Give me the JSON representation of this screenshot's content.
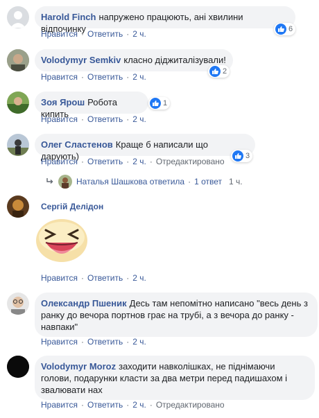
{
  "colors": {
    "link_blue": "#385898",
    "bubble_bg": "#f2f3f5",
    "meta_gray": "#606770",
    "like_blue": "#2078f4"
  },
  "labels": {
    "like": "Нравится",
    "reply": "Ответить",
    "edited": "Отредактировано",
    "separator": "·"
  },
  "comments": [
    {
      "author": "Harold Finch",
      "text": "напружено працюють, ані хвилини відпочинку",
      "time": "2 ч.",
      "likes": "6",
      "avatar": "default-avatar"
    },
    {
      "author": "Volodymyr Semkiv",
      "text": "класно діджиталізували!",
      "time": "2 ч.",
      "likes": "2",
      "avatar": "photo-avatar"
    },
    {
      "author": "Зоя Ярош",
      "text": "Робота кипить",
      "time": "2 ч.",
      "likes": "1",
      "avatar": "photo-avatar"
    },
    {
      "author": "Олег Сластенов",
      "text": "Краще б написали що дарують)",
      "time": "2 ч.",
      "likes": "3",
      "avatar": "photo-avatar",
      "edited": true
    },
    {
      "author": "Сергій Делідон",
      "text": "",
      "time": "2 ч.",
      "avatar": "photo-avatar",
      "sticker": "laughing-face-sticker"
    },
    {
      "author": "Олександр Пшеник",
      "text": "Десь там непомітно написано \"весь день з ранку до вечора портнов грає на трубі, а з вечора до ранку - навпаки\"",
      "time": "2 ч.",
      "avatar": "photo-avatar"
    },
    {
      "author": "Volodymyr Moroz",
      "text": "заходити навколішках, не піднімаючи голови, подарунки класти за два метри перед падишахом і звалювати нах",
      "time": "2 ч.",
      "avatar": "black-avatar",
      "edited": true
    }
  ],
  "reply_summary": {
    "text": "Наталья Шашкова ответила",
    "count": "1 ответ",
    "time": "1 ч."
  }
}
